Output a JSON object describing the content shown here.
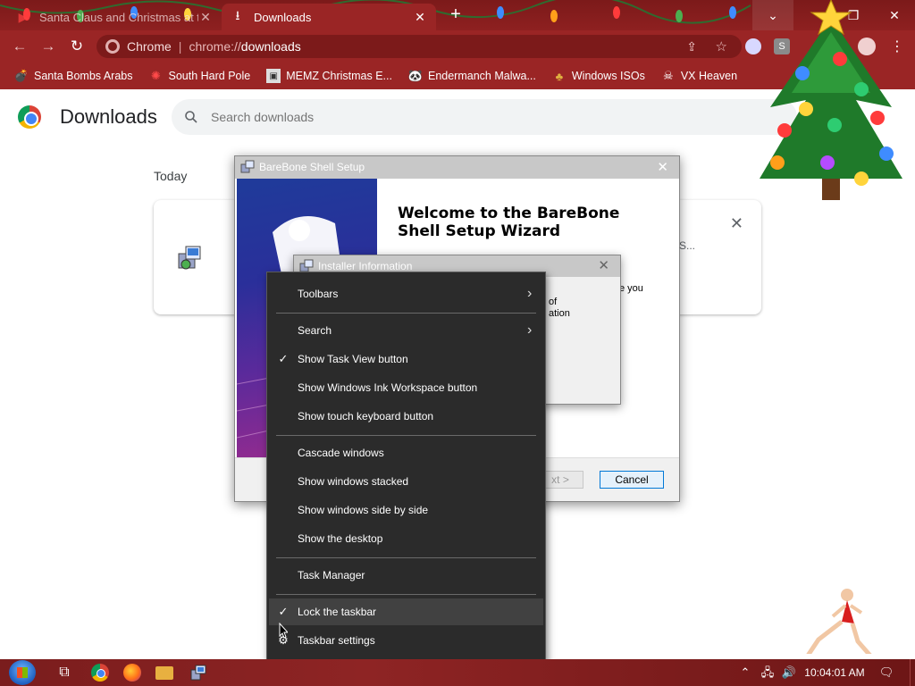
{
  "browser": {
    "tabs": [
      {
        "label": "Santa Claus and Christmas at th",
        "icon": "youtube-icon"
      },
      {
        "label": "Downloads",
        "icon": "download-icon"
      }
    ],
    "omnibox": {
      "site": "Chrome",
      "scheme": "chrome://",
      "path": "downloads"
    },
    "bookmarks": [
      {
        "label": "Santa Bombs Arabs",
        "icon": "bomb-icon"
      },
      {
        "label": "South Hard Pole",
        "icon": "flower-icon"
      },
      {
        "label": "MEMZ Christmas E...",
        "icon": "image-icon"
      },
      {
        "label": "Endermanch Malwa...",
        "icon": "bot-icon"
      },
      {
        "label": "Windows ISOs",
        "icon": "tree-icon"
      },
      {
        "label": "VX Heaven",
        "icon": "ghost-icon"
      }
    ],
    "extension_label": "S",
    "accent": "#9a2525"
  },
  "downloads": {
    "title": "Downloads",
    "search_placeholder": "Search downloads",
    "section": "Today",
    "card_ellipsis": "S..."
  },
  "wizard": {
    "title": "BareBone Shell Setup",
    "heading": "Welcome to the BareBone Shell Setup Wizard",
    "body_fragment": "e you",
    "next_label": "xt >",
    "cancel_label": "Cancel"
  },
  "installer_info": {
    "title": "Installer Information",
    "line1": "of",
    "line2": "ation"
  },
  "context_menu": {
    "groups": [
      [
        {
          "label": "Toolbars",
          "submenu": true,
          "checked": false
        }
      ],
      [
        {
          "label": "Search",
          "submenu": true,
          "checked": false
        },
        {
          "label": "Show Task View button",
          "submenu": false,
          "checked": true
        },
        {
          "label": "Show Windows Ink Workspace button",
          "submenu": false,
          "checked": false
        },
        {
          "label": "Show touch keyboard button",
          "submenu": false,
          "checked": false
        }
      ],
      [
        {
          "label": "Cascade windows",
          "submenu": false,
          "checked": false
        },
        {
          "label": "Show windows stacked",
          "submenu": false,
          "checked": false
        },
        {
          "label": "Show windows side by side",
          "submenu": false,
          "checked": false
        },
        {
          "label": "Show the desktop",
          "submenu": false,
          "checked": false
        }
      ],
      [
        {
          "label": "Task Manager",
          "submenu": false,
          "checked": false
        }
      ],
      [
        {
          "label": "Lock the taskbar",
          "submenu": false,
          "checked": true,
          "highlighted": true
        },
        {
          "label": "Taskbar settings",
          "submenu": false,
          "checked": false,
          "icon": "gear-icon"
        }
      ]
    ]
  },
  "taskbar": {
    "clock": "10:04:01 AM",
    "pinned": [
      "task-view-icon",
      "chrome-icon",
      "firefox-icon",
      "file-explorer-icon",
      "setup-icon"
    ]
  }
}
